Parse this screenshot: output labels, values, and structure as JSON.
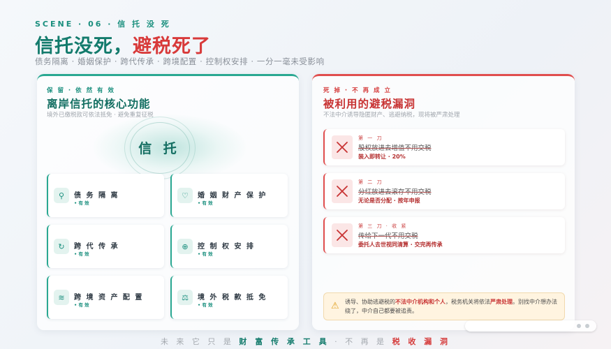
{
  "header": {
    "scene": "SCENE · 06 · 信 托 没 死",
    "title_part1": "信托没死，",
    "title_part2": "避税死了",
    "tags": "债务隔离 · 婚姻保护 · 跨代传承 · 跨境配置 · 控制权安排 · 一分一毫未受影响"
  },
  "left": {
    "kicker": "保 留 · 依 然 有 效",
    "title": "离岸信托的核心功能",
    "subtitle": "境外已缴税款可依法抵免 · 避免重复征税",
    "core_label": "信 托",
    "features": [
      {
        "icon": "pin-icon",
        "glyph": "⚲",
        "name": "债 务 隔 离",
        "status": "• 有 效"
      },
      {
        "icon": "heart-icon",
        "glyph": "♡",
        "name": "婚 姻 财 产 保 护",
        "status": "• 有 效"
      },
      {
        "icon": "refresh-icon",
        "glyph": "↻",
        "name": "跨 代 传 承",
        "status": "• 有 效"
      },
      {
        "icon": "crosshair-icon",
        "glyph": "⊕",
        "name": "控 制 权 安 排",
        "status": "• 有 效"
      },
      {
        "icon": "wave-icon",
        "glyph": "≋",
        "name": "跨 境 资 产 配 置",
        "status": "• 有 效"
      },
      {
        "icon": "scale-icon",
        "glyph": "⚖",
        "name": "境 外 税 款 抵 免",
        "status": "• 有 效"
      }
    ]
  },
  "right": {
    "kicker": "死 掉 · 不 再 成 立",
    "title": "被利用的避税漏洞",
    "subtitle": "不法中介诱导隐匿财产、逃避纳税，现将被严肃处理",
    "blades": [
      {
        "kicker": "第 一 刀",
        "text": "股权放进去增值不用交税",
        "note": "装入即转让 · 20%"
      },
      {
        "kicker": "第 二 刀",
        "text": "分红放进去滚存不用交税",
        "note": "无论是否分配 · 按年申报"
      },
      {
        "kicker": "第 三 刀 · 收 紧",
        "text": "传给下一代不用交税",
        "note": "委托人去世视同清算 · 交完再传承"
      }
    ],
    "warning": {
      "icon": "warning-icon",
      "t1": "诱导、协助逃避税的",
      "t2": "不法中介机构和个人",
      "t3": "，税务机关将依法",
      "t4": "严肃处理",
      "t5": "。别找中介想办法绕了，中介自己都要被追责。"
    }
  },
  "footer": {
    "a": "未 来 它 只 是 ",
    "b": "财 富 传 承 工 具",
    "c": " · 不 再 是 ",
    "d": "税 收 漏 洞"
  }
}
